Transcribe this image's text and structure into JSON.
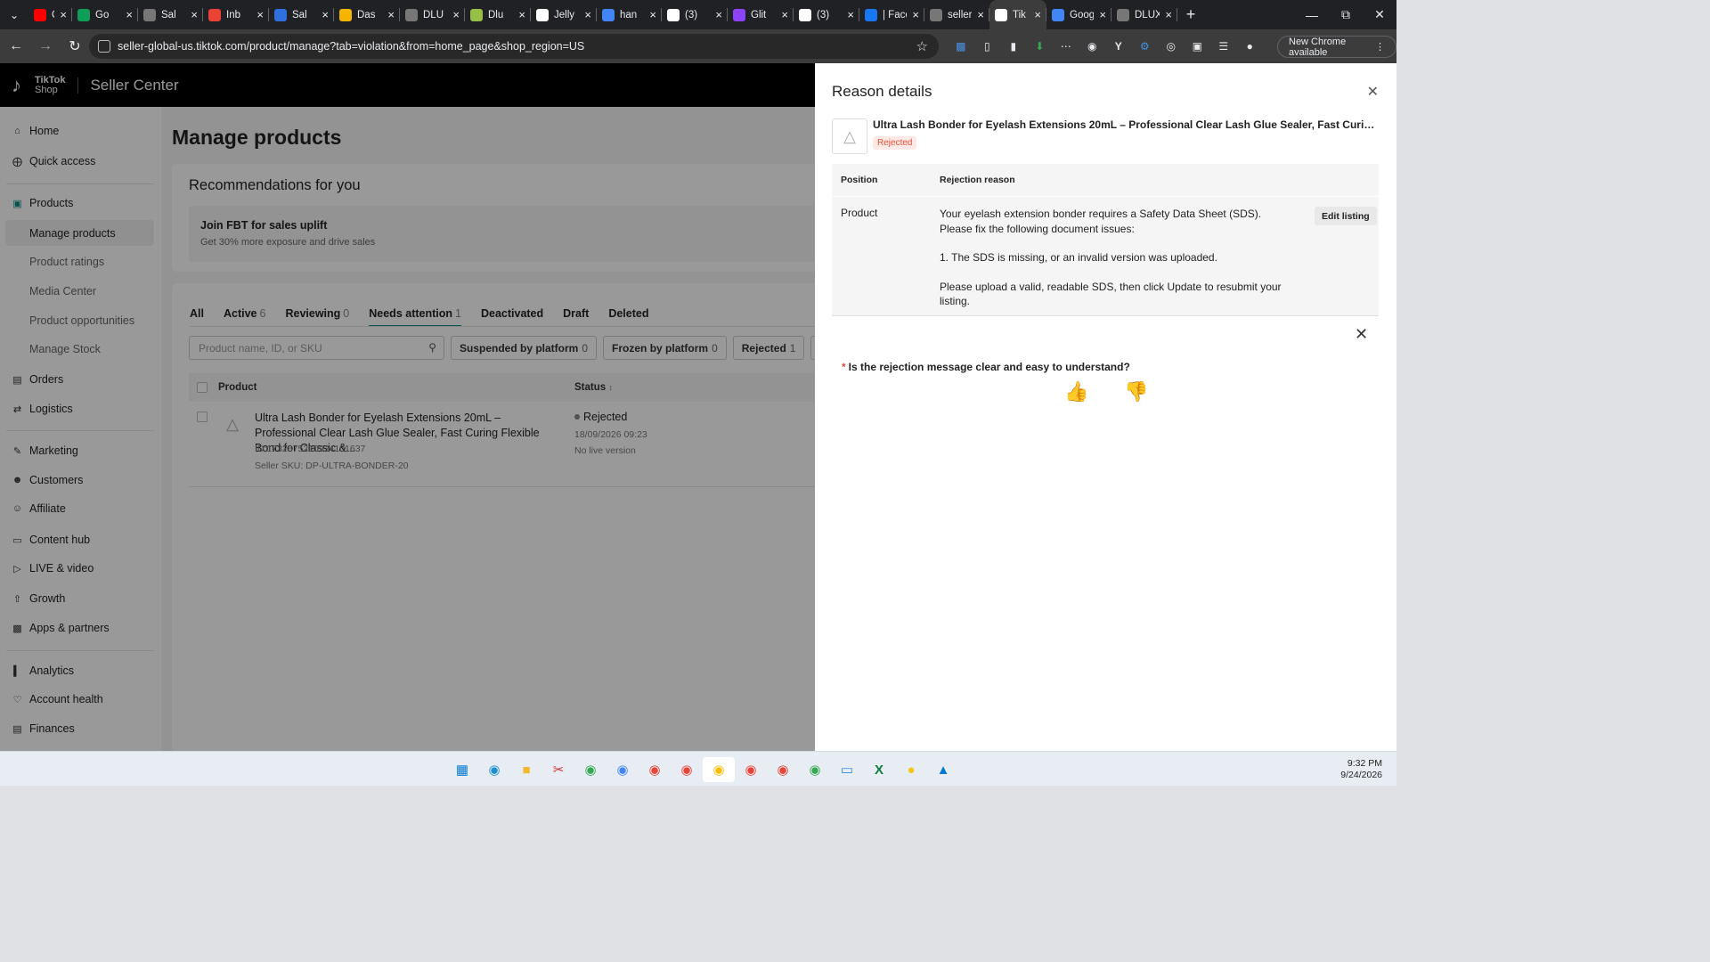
{
  "browser": {
    "tabs": [
      {
        "title": "Ch",
        "icon": "youtube-icon",
        "color": "#ff0000"
      },
      {
        "title": "Go",
        "icon": "sheets-icon",
        "color": "#0f9d58"
      },
      {
        "title": "Sal",
        "icon": "globe-icon",
        "color": "#777777"
      },
      {
        "title": "Inb",
        "icon": "gmail-icon",
        "color": "#ea4335"
      },
      {
        "title": "Sal",
        "icon": "shopify-s-icon",
        "color": "#2f6fde"
      },
      {
        "title": "Das",
        "icon": "analytics-icon",
        "color": "#f4b400"
      },
      {
        "title": "DLU",
        "icon": "globe-icon",
        "color": "#777777"
      },
      {
        "title": "Dlu",
        "icon": "shopify-icon",
        "color": "#95bf47"
      },
      {
        "title": "Jelly",
        "icon": "jelly-icon",
        "color": "#ffffff"
      },
      {
        "title": "han",
        "icon": "translate-icon",
        "color": "#4285f4"
      },
      {
        "title": "(3)",
        "icon": "notion-icon",
        "color": "#ffffff"
      },
      {
        "title": "Glit",
        "icon": "glitch-icon",
        "color": "#8e44ff"
      },
      {
        "title": "(3)",
        "icon": "notion-icon",
        "color": "#ffffff"
      },
      {
        "title": "| Facebo",
        "icon": "facebook-icon",
        "color": "#1877f2"
      },
      {
        "title": "seller-g",
        "icon": "globe-icon",
        "color": "#777777"
      },
      {
        "title": "Tik",
        "icon": "tiktok-icon",
        "color": "#ffffff",
        "active": true
      },
      {
        "title": "Google",
        "icon": "translate-icon",
        "color": "#4285f4"
      },
      {
        "title": "DLUX P",
        "icon": "globe-icon",
        "color": "#777777"
      }
    ],
    "url": "seller-global-us.tiktok.com/product/manage?tab=violation&from=home_page&shop_region=US",
    "new_chrome_label": "New Chrome available"
  },
  "app": {
    "brand_line1": "TikTok",
    "brand_line2": "Shop",
    "header_title": "Seller Center"
  },
  "sidebar": {
    "home": "Home",
    "quick_access": "Quick access",
    "products": "Products",
    "manage_products": "Manage products",
    "product_ratings": "Product ratings",
    "media_center": "Media Center",
    "product_opportunities": "Product opportunities",
    "manage_stock": "Manage Stock",
    "orders": "Orders",
    "logistics": "Logistics",
    "marketing": "Marketing",
    "customers": "Customers",
    "affiliate": "Affiliate",
    "content_hub": "Content hub",
    "live_video": "LIVE & video",
    "growth": "Growth",
    "apps_partners": "Apps & partners",
    "analytics": "Analytics",
    "account_health": "Account health",
    "finances": "Finances"
  },
  "main": {
    "title": "Manage products",
    "recommendations_title": "Recommendations for you",
    "fbt_title": "Join FBT for sales uplift",
    "fbt_subtitle": "Get 30% more exposure and drive sales",
    "tabs": [
      {
        "label": "All",
        "count": ""
      },
      {
        "label": "Active",
        "count": "6"
      },
      {
        "label": "Reviewing",
        "count": "0"
      },
      {
        "label": "Needs attention",
        "count": "1",
        "selected": true
      },
      {
        "label": "Deactivated",
        "count": ""
      },
      {
        "label": "Draft",
        "count": ""
      },
      {
        "label": "Deleted",
        "count": ""
      }
    ],
    "search_placeholder": "Product name, ID, or SKU",
    "chips": [
      {
        "label": "Suspended by platform",
        "count": "0"
      },
      {
        "label": "Frozen by platform",
        "count": "0"
      },
      {
        "label": "Rejected",
        "count": "1"
      },
      {
        "label": "Re",
        "count": ""
      }
    ],
    "col_product": "Product",
    "col_status": "Status",
    "row": {
      "name": "Ultra Lash Bonder for Eyelash Extensions 20mL – Professional Clear Lash Glue Sealer, Fast Curing Flexible Bond for Classic &...",
      "id": "ID:1732675210924101637",
      "sku": "Seller SKU: DP-ULTRA-BONDER-20",
      "status": "Rejected",
      "date": "18/09/2026 09:23",
      "live": "No live version"
    }
  },
  "drawer": {
    "title": "Reason details",
    "product_name": "Ultra Lash Bonder for Eyelash Extensions 20mL – Professional Clear Lash Glue Sealer, Fast Curing Flexible Bond for Classic & Volume Lashes",
    "badge": "Rejected",
    "col_position": "Position",
    "col_reason": "Rejection reason",
    "position": "Product",
    "reason_line1": "Your eyelash extension bonder requires a Safety Data Sheet (SDS).",
    "reason_line2": "Please fix the following document issues:",
    "reason_line3": "1. The SDS is missing, or an invalid version was uploaded.",
    "reason_line4": "Please upload a valid, readable SDS, then click Update to resubmit your listing.",
    "edit_label": "Edit listing",
    "feedback_required": "*",
    "feedback_question": "Is the rejection message clear and easy to understand?"
  },
  "taskbar": {
    "time": "9:32 PM",
    "date": "9/24/2026"
  }
}
